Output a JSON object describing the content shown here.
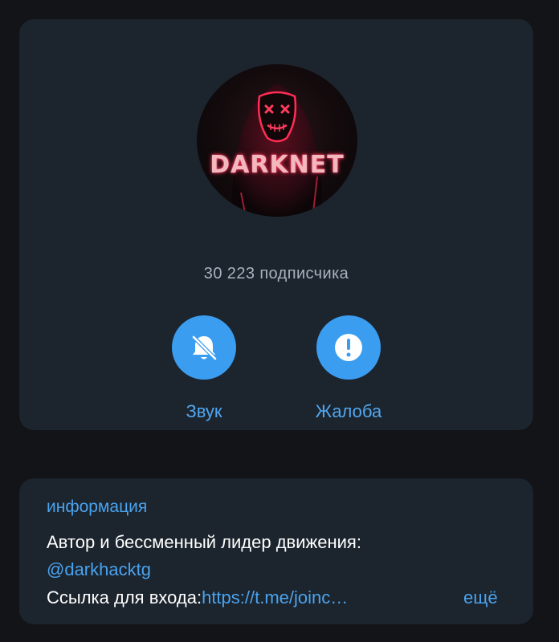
{
  "channel": {
    "avatar_text": "DARKNET",
    "subscribers": "30 223 подписчика"
  },
  "actions": {
    "sound": {
      "label": "Звук",
      "icon": "bell-muted-icon"
    },
    "report": {
      "label": "Жалоба",
      "icon": "exclamation-icon"
    }
  },
  "info": {
    "section_label": "информация",
    "line1": "Автор и бессменный лидер движения:",
    "mention": "@darkhacktg",
    "line3_prefix": "Ссылка для входа:",
    "line3_link": "https://t.me/joinc…",
    "more": "ещё"
  },
  "colors": {
    "background": "#121417",
    "card": "#1c242d",
    "accent": "#3b9df0",
    "link": "#4aa3ef"
  }
}
